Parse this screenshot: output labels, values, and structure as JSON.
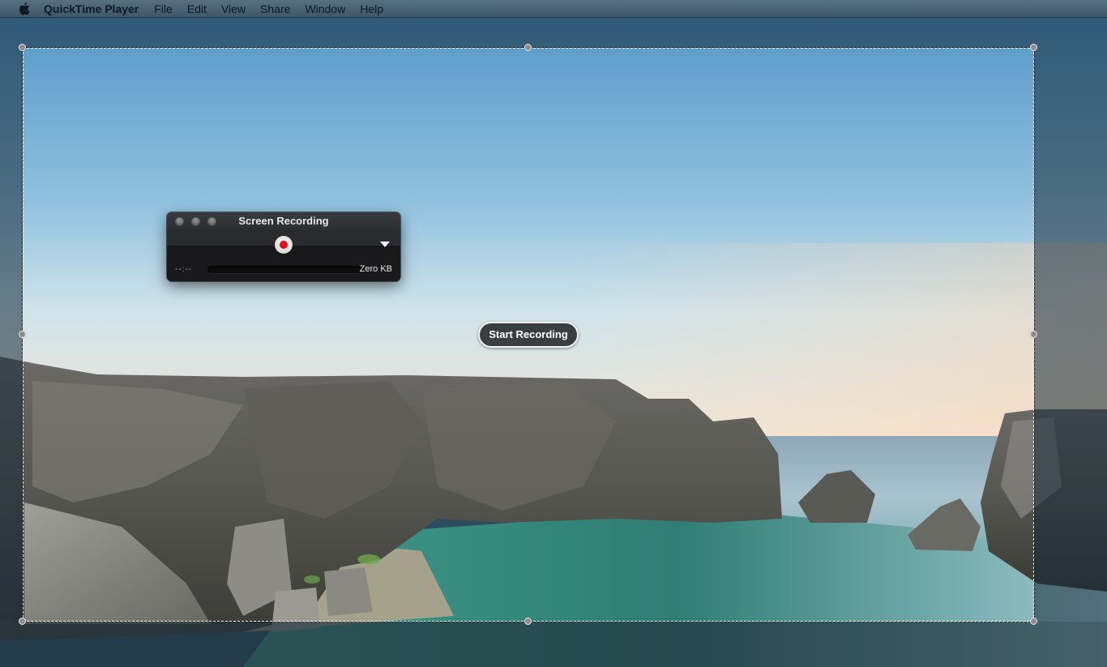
{
  "menubar": {
    "apple_icon": "apple-logo-icon",
    "app_name": "QuickTime Player",
    "items": [
      "File",
      "Edit",
      "View",
      "Share",
      "Window",
      "Help"
    ]
  },
  "hud": {
    "title": "Screen Recording",
    "window_controls": [
      "close",
      "minimize",
      "zoom"
    ],
    "record_icon": "record-icon",
    "options_icon": "options-triangle-icon",
    "elapsed_time": "--:--",
    "file_size": "Zero KB",
    "progress": 0
  },
  "selection": {
    "start_button_label": "Start Recording"
  },
  "colors": {
    "record_red": "#e0101a",
    "hud_background": "#1f2022",
    "pill_background": "#3b3e41"
  }
}
